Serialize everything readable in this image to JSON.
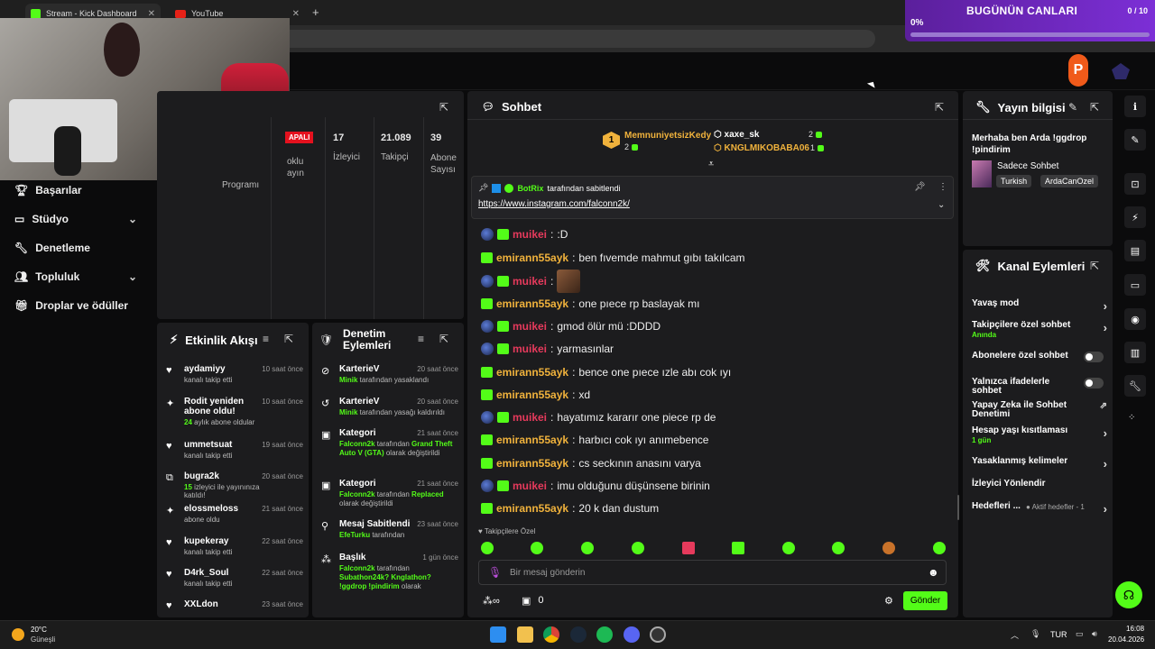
{
  "browser": {
    "tabs": [
      {
        "title": "Stream - Kick Dashboard",
        "icon": "kick-icon"
      },
      {
        "title": "YouTube",
        "icon": "youtube-icon"
      }
    ]
  },
  "goal_overlay": {
    "title": "BUGÜNÜN CANLARI",
    "count": "0 / 10",
    "percent": "0%",
    "progress": 0.0
  },
  "sidebar": {
    "items": [
      {
        "label": "Başarılar",
        "icon": "trophy-icon"
      },
      {
        "label": "Stüdyo",
        "icon": "studio-icon",
        "expandable": true
      },
      {
        "label": "Denetleme",
        "icon": "wrench-icon"
      },
      {
        "label": "Topluluk",
        "icon": "community-icon",
        "expandable": true
      },
      {
        "label": "Droplar ve ödüller",
        "icon": "gift-icon"
      }
    ]
  },
  "stats": {
    "live_badge": "APALI",
    "program": "Programı",
    "multi": [
      "oklu",
      "ayın"
    ],
    "viewers_value": "17",
    "viewers_label": "İzleyici",
    "followers_value": "21.089",
    "followers_label": "Takipçi",
    "subs_value": "39",
    "subs_label": "Abone Sayısı"
  },
  "activity": {
    "title": "Etkinlik Akışı",
    "items": [
      {
        "name": "aydamiyy",
        "desc": "kanalı takip etti",
        "time": "10 saat önce",
        "icon": "heart-icon"
      },
      {
        "name": "Rodit yeniden abone oldu!",
        "desc_green": "24",
        "desc": "aylık abone oldular",
        "time": "10 saat önce",
        "icon": "sparkle-icon"
      },
      {
        "name": "ummetsuat",
        "desc": "kanalı takip etti",
        "time": "19 saat önce",
        "icon": "heart-icon"
      },
      {
        "name": "bugra2k",
        "desc_green": "15",
        "desc": "izleyici ile yayınınıza katıldı!",
        "time": "20 saat önce",
        "icon": "raid-icon"
      },
      {
        "name": "elossmeloss",
        "desc": "abone oldu",
        "time": "21 saat önce",
        "icon": "sparkle-icon"
      },
      {
        "name": "kupekeray",
        "desc": "kanalı takip etti",
        "time": "22 saat önce",
        "icon": "heart-icon"
      },
      {
        "name": "D4rk_Soul",
        "desc": "kanalı takip etti",
        "time": "22 saat önce",
        "icon": "heart-icon"
      },
      {
        "name": "XXLdon",
        "desc": "",
        "time": "23 saat önce",
        "icon": "heart-icon"
      }
    ]
  },
  "moderation": {
    "title": "Denetim Eylemleri",
    "items": [
      {
        "name": "KarterieV",
        "green": "Minik",
        "desc": "tarafından yasaklandı",
        "time": "20 saat önce",
        "icon": "ban-icon"
      },
      {
        "name": "KarterieV",
        "green": "Minik",
        "desc": "tarafından yasağı kaldırıldı",
        "time": "20 saat önce",
        "icon": "undo-icon"
      },
      {
        "name": "Kategori",
        "green": "Falconn2k",
        "desc": "tarafından",
        "green2": "Grand Theft Auto V (GTA)",
        "desc2": "olarak değiştirildi",
        "time": "21 saat önce",
        "icon": "category-icon"
      },
      {
        "name": "Kategori",
        "green": "Falconn2k",
        "desc": "tarafından",
        "green2": "Replaced",
        "desc2": "olarak değiştirildi",
        "time": "21 saat önce",
        "icon": "category-icon"
      },
      {
        "name": "Mesaj Sabitlendi",
        "green": "EfeTurku",
        "desc": "tarafından",
        "time": "23 saat önce",
        "icon": "pin-icon"
      },
      {
        "name": "Başlık",
        "green": "Falconn2k",
        "desc": "tarafından",
        "green2": "Subathon24k? Knglathon? !ggdrop !pindirim",
        "desc2": "olarak",
        "time": "1 gün önce",
        "icon": "title-icon"
      }
    ]
  },
  "chat": {
    "title": "Sohbet",
    "top_gifters": [
      {
        "name": "MemnuniyetsizKedy",
        "count": "2"
      },
      {
        "name": "xaxe_sk",
        "count": "2"
      },
      {
        "name": "KNGLMIKOBABA06",
        "count": "1"
      }
    ],
    "pinned": {
      "by": "BotRix",
      "by_suffix": "tarafından sabitlendi",
      "link": "https://www.instagram.com/falconn2k/"
    },
    "messages": [
      {
        "user": "muikei",
        "text": ":D",
        "type": "mod"
      },
      {
        "user": "emirann55ayk",
        "text": "ben fıvemde mahmut gıbı takılcam",
        "type": "sub"
      },
      {
        "user": "muikei",
        "text": "",
        "type": "mod",
        "emote": true
      },
      {
        "user": "emirann55ayk",
        "text": "one pıece rp baslayak mı",
        "type": "sub"
      },
      {
        "user": "muikei",
        "text": "gmod ölür mü :DDDD",
        "type": "mod"
      },
      {
        "user": "muikei",
        "text": "yarmasınlar",
        "type": "mod"
      },
      {
        "user": "emirann55ayk",
        "text": "bence one pıece ızle abı cok ıyı",
        "type": "sub"
      },
      {
        "user": "emirann55ayk",
        "text": "xd",
        "type": "sub"
      },
      {
        "user": "muikei",
        "text": "hayatımız kararır one piece rp de",
        "type": "mod"
      },
      {
        "user": "emirann55ayk",
        "text": "harbıcı cok ıyı anımebence",
        "type": "sub"
      },
      {
        "user": "emirann55ayk",
        "text": "cs seckının anasını varya",
        "type": "sub"
      },
      {
        "user": "muikei",
        "text": "imu olduğunu düşünsene birinin",
        "type": "mod"
      },
      {
        "user": "emirann55ayk",
        "text": "20 k dan dustum",
        "type": "sub"
      }
    ],
    "follower_only": "Takipçilere Özel",
    "input_placeholder": "Bir mesaj gönderin",
    "points": "0",
    "send_label": "Gönder"
  },
  "stream_info": {
    "title": "Yayın bilgisi",
    "stream_title": "Merhaba ben Arda !ggdrop !pindirim",
    "category": "Sadece Sohbet",
    "tags": [
      "Turkish",
      "ArdaCanOzel"
    ]
  },
  "channel_actions": {
    "title": "Kanal Eylemleri",
    "items": [
      {
        "label": "Yavaş mod",
        "control": "arrow"
      },
      {
        "label": "Takipçilere özel sohbet",
        "sub": "Anında",
        "control": "arrow"
      },
      {
        "label": "Abonelere özel sohbet",
        "control": "toggle"
      },
      {
        "label": "Yalnızca ifadelerle sohbet",
        "control": "toggle"
      },
      {
        "label": "Yapay Zeka ile Sohbet Denetimi",
        "control": "external"
      },
      {
        "label": "Hesap yaşı kısıtlaması",
        "sub": "1 gün",
        "control": "arrow"
      },
      {
        "label": "Yasaklanmış kelimeler",
        "control": "arrow"
      },
      {
        "label": "İzleyici Yönlendir",
        "control": "none"
      },
      {
        "label": "Hedefleri ...",
        "sub_inline": "Aktif hedefler - 1",
        "control": "arrow"
      }
    ]
  },
  "taskbar": {
    "weather_temp": "20°C",
    "weather_desc": "Güneşli",
    "lang": "TUR",
    "time": "16:08",
    "date": "20.04.2026"
  },
  "colors": {
    "accent": "#53fc18",
    "panel": "#1c1c1e",
    "bg": "#0b0b0c",
    "sub_user": "#f0b23c",
    "mod_user": "#e63a5c"
  }
}
